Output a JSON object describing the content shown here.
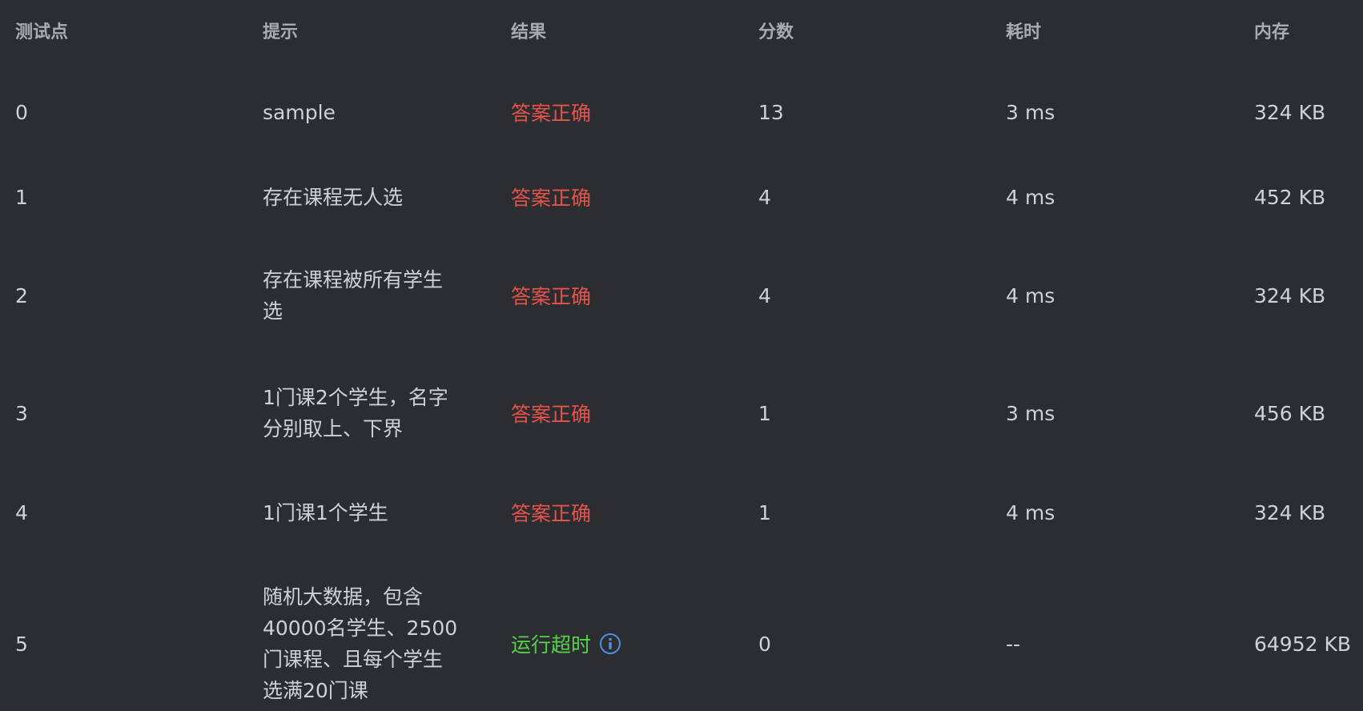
{
  "headers": [
    "测试点",
    "提示",
    "结果",
    "分数",
    "耗时",
    "内存"
  ],
  "rows": [
    {
      "id": "0",
      "hint": [
        "sample"
      ],
      "result": "答案正确",
      "result_status": "ok",
      "score": "13",
      "time": "3 ms",
      "memory": "324 KB"
    },
    {
      "id": "1",
      "hint": [
        "存在课程无人选"
      ],
      "result": "答案正确",
      "result_status": "ok",
      "score": "4",
      "time": "4 ms",
      "memory": "452 KB"
    },
    {
      "id": "2",
      "hint": [
        "存在课程被所有学生",
        "选"
      ],
      "result": "答案正确",
      "result_status": "ok",
      "score": "4",
      "time": "4 ms",
      "memory": "324 KB"
    },
    {
      "id": "3",
      "hint": [
        "1门课2个学生，名字",
        "分别取上、下界"
      ],
      "result": "答案正确",
      "result_status": "ok",
      "score": "1",
      "time": "3 ms",
      "memory": "456 KB"
    },
    {
      "id": "4",
      "hint": [
        "1门课1个学生"
      ],
      "result": "答案正确",
      "result_status": "ok",
      "score": "1",
      "time": "4 ms",
      "memory": "324 KB"
    },
    {
      "id": "5",
      "hint": [
        "随机大数据，包含",
        "40000名学生、2500",
        "门课程、且每个学生",
        "选满20门课"
      ],
      "result": "运行超时",
      "result_status": "tle",
      "score": "0",
      "time": "--",
      "memory": "64952 KB"
    }
  ],
  "colors": {
    "background": "#2b2d31",
    "text": "#cfd1d5",
    "header_text": "#a9abb0",
    "result_ok": "#e5534b",
    "result_tle": "#57d14a",
    "info_icon": "#4a90e2"
  },
  "icons": {
    "info": "info-circle-icon"
  }
}
